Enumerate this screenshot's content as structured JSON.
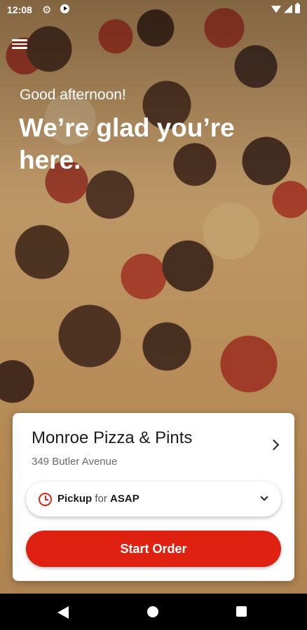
{
  "status_bar": {
    "time": "12:08"
  },
  "hero": {
    "greeting": "Good afternoon!",
    "headline": "We’re glad you’re here."
  },
  "card": {
    "restaurant_name": "Monroe Pizza & Pints",
    "address": "349 Butler Avenue",
    "order_type": "Pickup",
    "for_text": "for",
    "time_value": "ASAP",
    "start_button_label": "Start Order"
  },
  "colors": {
    "accent_red": "#de2110",
    "card_bg": "#ffffff",
    "text_dark": "#1d1d1d",
    "text_muted": "#6b6b6b"
  },
  "icons": {
    "menu": "hamburger-menu-icon",
    "clock": "clock-icon",
    "chevron_right": "chevron-right-icon",
    "chevron_down": "chevron-down-icon"
  }
}
